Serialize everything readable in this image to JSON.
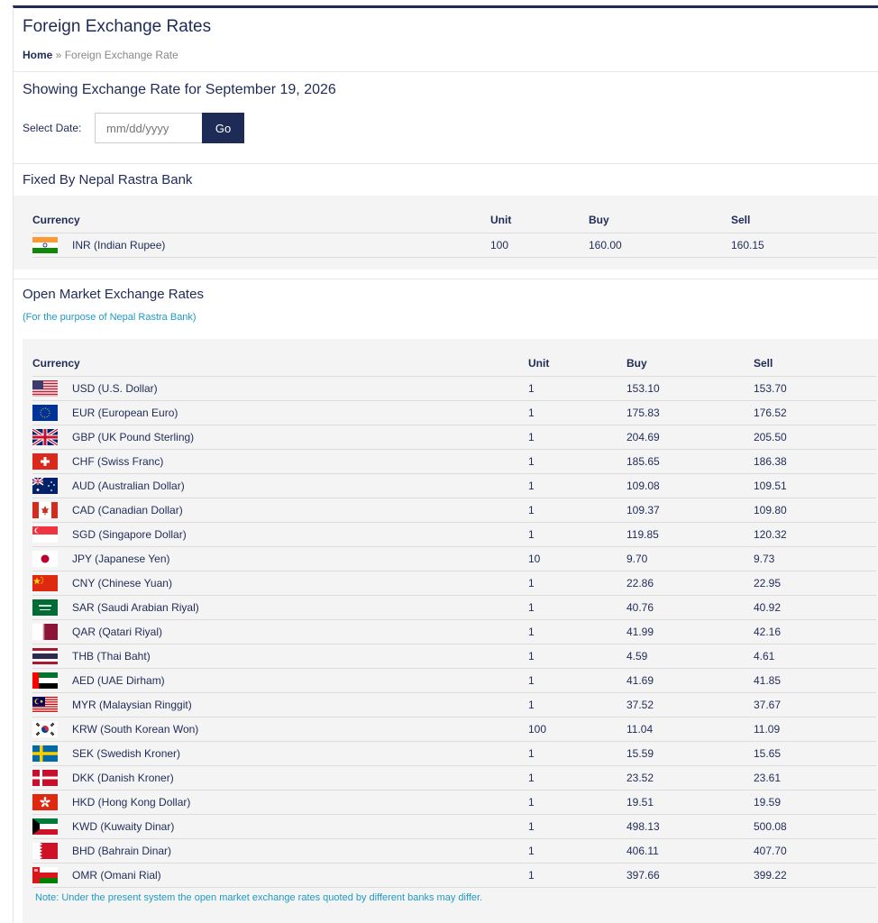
{
  "header": {
    "title": "Foreign Exchange Rates",
    "breadcrumb_home": "Home",
    "breadcrumb_sep": " » ",
    "breadcrumb_current": "Foreign Exchange Rate"
  },
  "date_form": {
    "showing": "Showing Exchange Rate for September 19, 2026",
    "label": "Select Date:",
    "placeholder": "mm/dd/yyyy",
    "go_label": "Go"
  },
  "fixed": {
    "title": "Fixed By Nepal Rastra Bank",
    "headers": [
      "Currency",
      "Unit",
      "Buy",
      "Sell"
    ],
    "rows": [
      {
        "flag": "in",
        "currency": "INR (Indian Rupee)",
        "unit": "100",
        "buy": "160.00",
        "sell": "160.15"
      }
    ]
  },
  "open_market": {
    "title": "Open Market Exchange Rates",
    "subtitle": "(For the purpose of Nepal Rastra Bank)",
    "headers": [
      "Currency",
      "Unit",
      "Buy",
      "Sell"
    ],
    "rows": [
      {
        "flag": "us",
        "currency": "USD (U.S. Dollar)",
        "unit": "1",
        "buy": "153.10",
        "sell": "153.70"
      },
      {
        "flag": "eu",
        "currency": "EUR (European Euro)",
        "unit": "1",
        "buy": "175.83",
        "sell": "176.52"
      },
      {
        "flag": "gb",
        "currency": "GBP (UK Pound Sterling)",
        "unit": "1",
        "buy": "204.69",
        "sell": "205.50"
      },
      {
        "flag": "ch",
        "currency": "CHF (Swiss Franc)",
        "unit": "1",
        "buy": "185.65",
        "sell": "186.38"
      },
      {
        "flag": "au",
        "currency": "AUD (Australian Dollar)",
        "unit": "1",
        "buy": "109.08",
        "sell": "109.51"
      },
      {
        "flag": "ca",
        "currency": "CAD (Canadian Dollar)",
        "unit": "1",
        "buy": "109.37",
        "sell": "109.80"
      },
      {
        "flag": "sg",
        "currency": "SGD (Singapore Dollar)",
        "unit": "1",
        "buy": "119.85",
        "sell": "120.32"
      },
      {
        "flag": "jp",
        "currency": "JPY (Japanese Yen)",
        "unit": "10",
        "buy": "9.70",
        "sell": "9.73"
      },
      {
        "flag": "cn",
        "currency": "CNY (Chinese Yuan)",
        "unit": "1",
        "buy": "22.86",
        "sell": "22.95"
      },
      {
        "flag": "sa",
        "currency": "SAR (Saudi Arabian Riyal)",
        "unit": "1",
        "buy": "40.76",
        "sell": "40.92"
      },
      {
        "flag": "qa",
        "currency": "QAR (Qatari Riyal)",
        "unit": "1",
        "buy": "41.99",
        "sell": "42.16"
      },
      {
        "flag": "th",
        "currency": "THB (Thai Baht)",
        "unit": "1",
        "buy": "4.59",
        "sell": "4.61"
      },
      {
        "flag": "ae",
        "currency": "AED (UAE Dirham)",
        "unit": "1",
        "buy": "41.69",
        "sell": "41.85"
      },
      {
        "flag": "my",
        "currency": "MYR (Malaysian Ringgit)",
        "unit": "1",
        "buy": "37.52",
        "sell": "37.67"
      },
      {
        "flag": "kr",
        "currency": "KRW (South Korean Won)",
        "unit": "100",
        "buy": "11.04",
        "sell": "11.09"
      },
      {
        "flag": "se",
        "currency": "SEK (Swedish Kroner)",
        "unit": "1",
        "buy": "15.59",
        "sell": "15.65"
      },
      {
        "flag": "dk",
        "currency": "DKK (Danish Kroner)",
        "unit": "1",
        "buy": "23.52",
        "sell": "23.61"
      },
      {
        "flag": "hk",
        "currency": "HKD (Hong Kong Dollar)",
        "unit": "1",
        "buy": "19.51",
        "sell": "19.59"
      },
      {
        "flag": "kw",
        "currency": "KWD (Kuwaity Dinar)",
        "unit": "1",
        "buy": "498.13",
        "sell": "500.08"
      },
      {
        "flag": "bh",
        "currency": "BHD (Bahrain Dinar)",
        "unit": "1",
        "buy": "406.11",
        "sell": "407.70"
      },
      {
        "flag": "om",
        "currency": "OMR (Omani Rial)",
        "unit": "1",
        "buy": "397.66",
        "sell": "399.22"
      }
    ],
    "note": "Note: Under the present system the open market exchange rates quoted by different banks may differ."
  },
  "colors": {
    "primary": "#1f2b57",
    "accent": "#1b9bc4",
    "panel": "#f4f4f4"
  }
}
